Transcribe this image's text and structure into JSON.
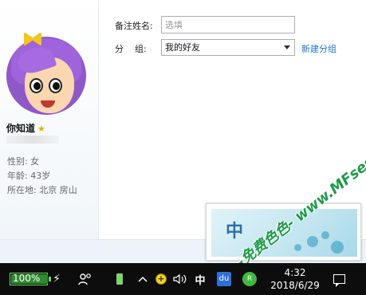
{
  "profile": {
    "nickname": "你知道",
    "star_icon": "star-icon",
    "gender": "性别: 女",
    "age": "年龄: 43岁",
    "location": "所在地: 北京  房山"
  },
  "form": {
    "remark_label": "备注姓名:",
    "remark_placeholder": "选填",
    "remark_value": "",
    "group_label": "分    组:",
    "group_selected": "我的好友",
    "new_group_link": "新建分组"
  },
  "ime_popup": {
    "char": "中"
  },
  "watermark": {
    "text": "-免费色色- www.MFsese.com"
  },
  "taskbar": {
    "battery_percent": "100%",
    "battery_level": 1.0,
    "ime_indicator": "中",
    "baidu_label": "du",
    "wechat_label": "R",
    "time": "4:32",
    "date": "2018/6/29"
  },
  "colors": {
    "link": "#1f73c7",
    "taskbar": "#0d0d0d",
    "battery": "#6cd66c",
    "avatar_hair": "#9f63db"
  }
}
